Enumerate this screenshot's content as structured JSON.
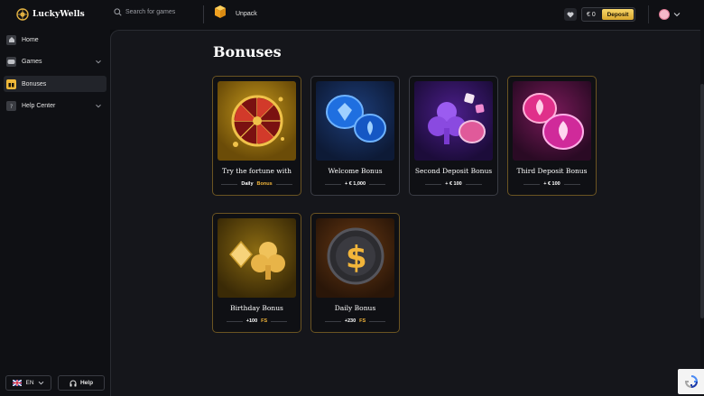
{
  "brand": {
    "name": "LuckyWells"
  },
  "search": {
    "placeholder": "Search for games"
  },
  "unpack": {
    "label": "Unpack"
  },
  "wallet": {
    "balance": "€ 0",
    "deposit_label": "Deposit"
  },
  "sidebar": {
    "items": [
      {
        "label": "Home",
        "icon": "home-icon",
        "has_chevron": false,
        "active": false
      },
      {
        "label": "Games",
        "icon": "games-icon",
        "has_chevron": true,
        "active": false
      },
      {
        "label": "Bonuses",
        "icon": "gift-icon",
        "has_chevron": false,
        "active": true
      },
      {
        "label": "Help Center",
        "icon": "help-icon",
        "has_chevron": true,
        "active": false
      }
    ],
    "language": "EN",
    "help_label": "Help"
  },
  "main": {
    "title": "Bonuses",
    "cards": [
      {
        "title": "Try the fortune with",
        "sub_prefix": "Daily",
        "sub_accent": "Bonus",
        "art": "fortune-wheel"
      },
      {
        "title": "Welcome Bonus",
        "sub_prefix": "+ € 1,000",
        "sub_accent": "",
        "art": "blue-chips"
      },
      {
        "title": "Second Deposit Bonus",
        "sub_prefix": "+ € 100",
        "sub_accent": "",
        "art": "purple-club"
      },
      {
        "title": "Third Deposit Bonus",
        "sub_prefix": "+ € 100",
        "sub_accent": "",
        "art": "pink-chips"
      },
      {
        "title": "Birthday Bonus",
        "sub_prefix": "+100",
        "sub_accent": "FS",
        "art": "gold-suits"
      },
      {
        "title": "Daily Bonus",
        "sub_prefix": "+230",
        "sub_accent": "FS",
        "art": "dollar-coin"
      }
    ]
  },
  "colors": {
    "accent": "#f0b93a",
    "background": "#15161b",
    "sidebar": "#0f1014"
  }
}
